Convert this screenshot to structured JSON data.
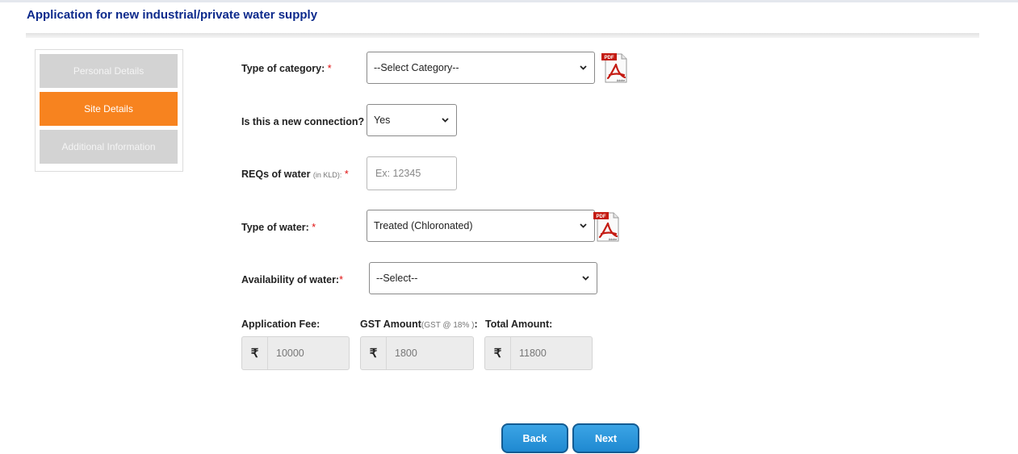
{
  "page": {
    "title": "Application for new industrial/private water supply"
  },
  "sidebar": {
    "items": [
      {
        "label": "Personal Details",
        "state": "disabled"
      },
      {
        "label": "Site Details",
        "state": "active"
      },
      {
        "label": "Additional Information",
        "state": "disabled"
      }
    ]
  },
  "form": {
    "category": {
      "label": "Type of category:",
      "required": "*",
      "value": "--Select Category--"
    },
    "new_connection": {
      "label": "Is this a new connection?",
      "required": "*",
      "value": "Yes"
    },
    "water_req": {
      "label": "REQs of water",
      "unit": "(in KLD):",
      "required": "*",
      "placeholder": "Ex: 12345"
    },
    "water_type": {
      "label": "Type of water:",
      "required": "*",
      "value": "Treated (Chloronated)"
    },
    "availability": {
      "label": "Availability of water:",
      "required": "*",
      "value": "--Select--"
    }
  },
  "fees": {
    "currency": "₹",
    "application_fee": {
      "label": "Application Fee:",
      "value": "10000"
    },
    "gst": {
      "label": "GST Amount",
      "note": "(GST @ 18% )",
      "suffix": ":",
      "value": "1800"
    },
    "total": {
      "label": "Total Amount:",
      "value": "11800"
    }
  },
  "buttons": {
    "back": "Back",
    "next": "Next"
  },
  "colors": {
    "title": "#0d2a8c",
    "active_tab": "#f7831f",
    "disabled_tab": "#d3d3d3",
    "button": "#1f89d1",
    "required": "#e01010"
  },
  "icons": {
    "pdf": "pdf-icon",
    "dropdown": "chevron-down-icon"
  }
}
